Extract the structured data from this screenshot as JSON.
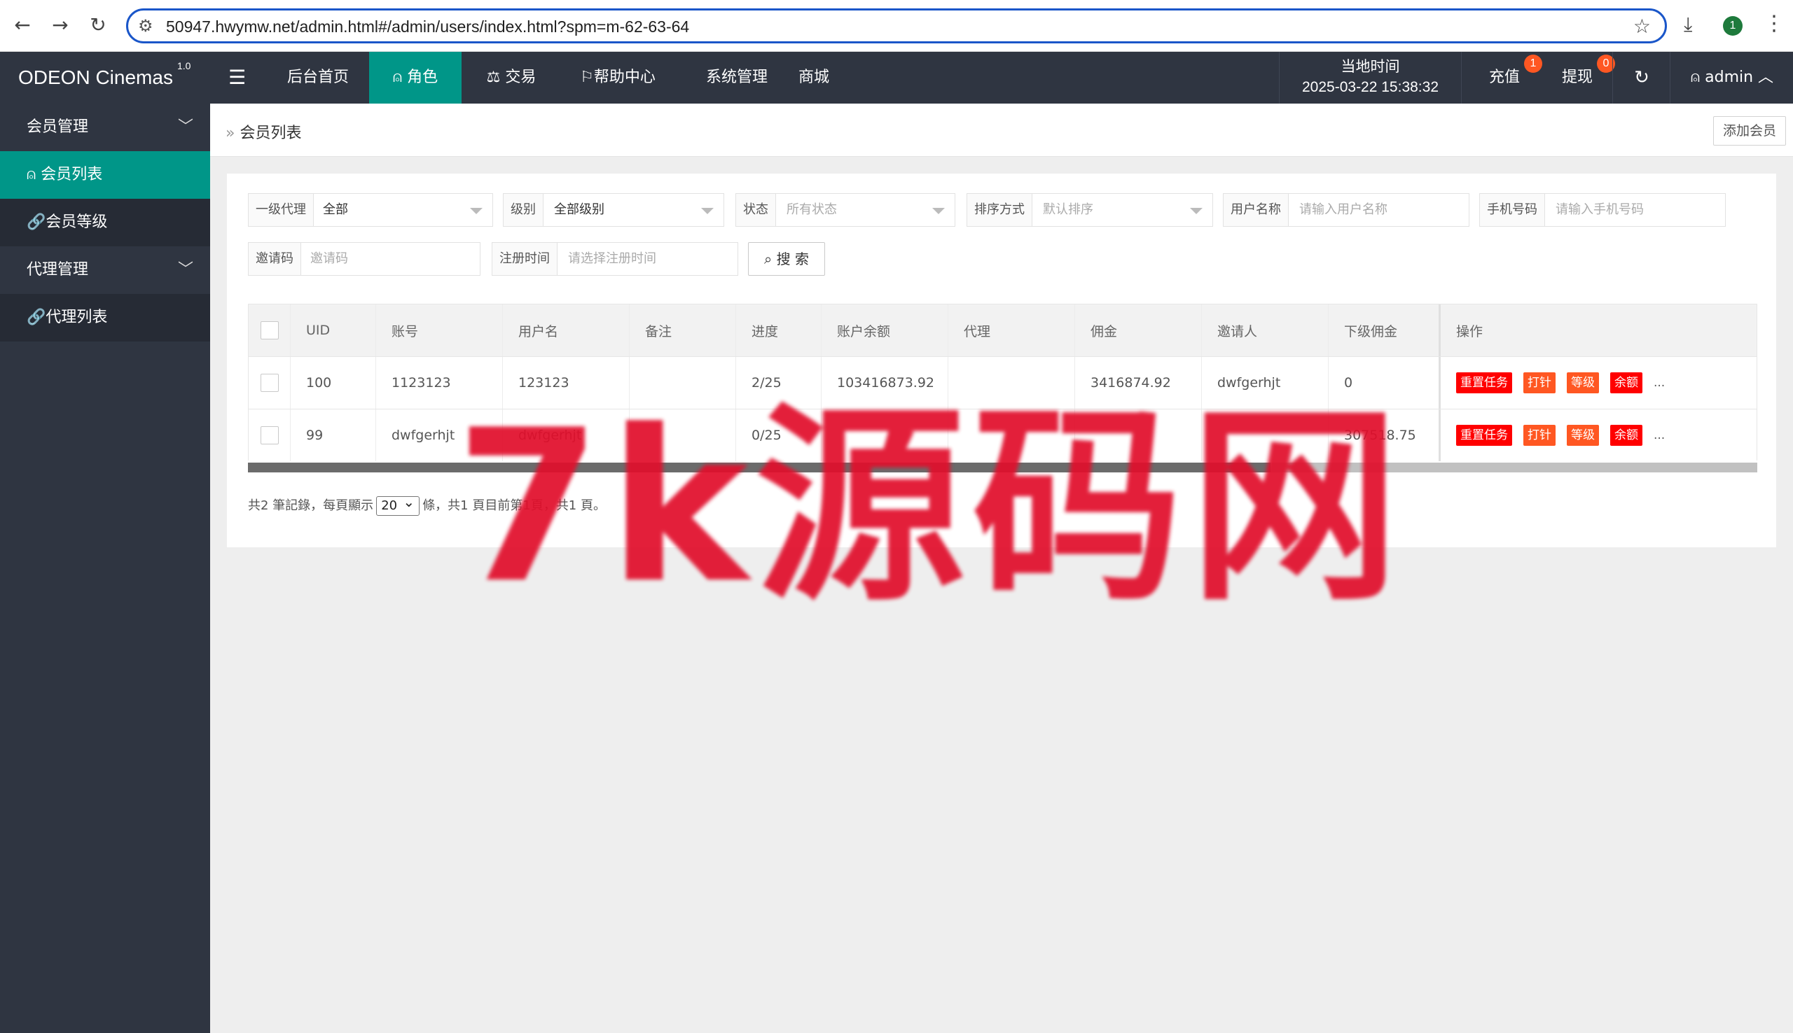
{
  "browser": {
    "url": "50947.hwymw.net/admin.html#/admin/users/index.html?spm=m-62-63-64",
    "profile_badge": "1"
  },
  "header": {
    "logo": "ODEON Cinemas",
    "version": "1.0",
    "nav": [
      "后台首页",
      "角色",
      "交易",
      "帮助中心",
      "系统管理",
      "商城"
    ],
    "active_nav": "角色",
    "time_label": "当地时间",
    "time_value": "2025-03-22 15:38:32",
    "recharge": "充值",
    "recharge_badge": "1",
    "withdraw": "提现",
    "withdraw_badge": "0",
    "user": "admin"
  },
  "sidebar": {
    "groups": [
      {
        "label": "会员管理",
        "items": [
          "会员列表",
          "会员等级"
        ]
      },
      {
        "label": "代理管理",
        "items": [
          "代理列表"
        ]
      }
    ],
    "active_item": "会员列表"
  },
  "breadcrumb": {
    "current": "会员列表",
    "add_button": "添加会员"
  },
  "filters": {
    "agent": {
      "label": "一级代理",
      "value": "全部"
    },
    "level": {
      "label": "级别",
      "value": "全部级别"
    },
    "status": {
      "label": "状态",
      "placeholder": "所有状态"
    },
    "sort": {
      "label": "排序方式",
      "placeholder": "默认排序"
    },
    "username": {
      "label": "用户名称",
      "placeholder": "请输入用户名称"
    },
    "phone": {
      "label": "手机号码",
      "placeholder": "请输入手机号码"
    },
    "invite": {
      "label": "邀请码",
      "placeholder": "邀请码"
    },
    "regtime": {
      "label": "注册时间",
      "placeholder": "请选择注册时间"
    },
    "search_button": "搜 索"
  },
  "table": {
    "columns": [
      "UID",
      "账号",
      "用户名",
      "备注",
      "进度",
      "账户余额",
      "代理",
      "佣金",
      "邀请人",
      "下级佣金",
      "操作"
    ],
    "rows": [
      {
        "uid": "100",
        "account": "1123123",
        "username": "123123",
        "note": "",
        "progress": "2/25",
        "balance": "103416873.92",
        "agent": "",
        "commission": "3416874.92",
        "inviter": "dwfgerhjt",
        "sub_commission": "0"
      },
      {
        "uid": "99",
        "account": "dwfgerhjt",
        "username": "dwfgerhjt",
        "note": "",
        "progress": "0/25",
        "balance": "",
        "agent": "",
        "commission": "",
        "inviter": "",
        "sub_commission": "307518.75"
      }
    ],
    "actions": [
      "重置任务",
      "打针",
      "等级",
      "余额",
      "..."
    ]
  },
  "pager": {
    "prefix": "共2 筆記錄，每頁顯示",
    "page_size": "20",
    "suffix": "條，共1 頁目前第1頁，共1 頁。"
  },
  "watermark": "7k源码网",
  "colors": {
    "accent": "#009688",
    "header_bg": "#2f3541",
    "danger": "#ff0000",
    "warn": "#ff5722"
  }
}
